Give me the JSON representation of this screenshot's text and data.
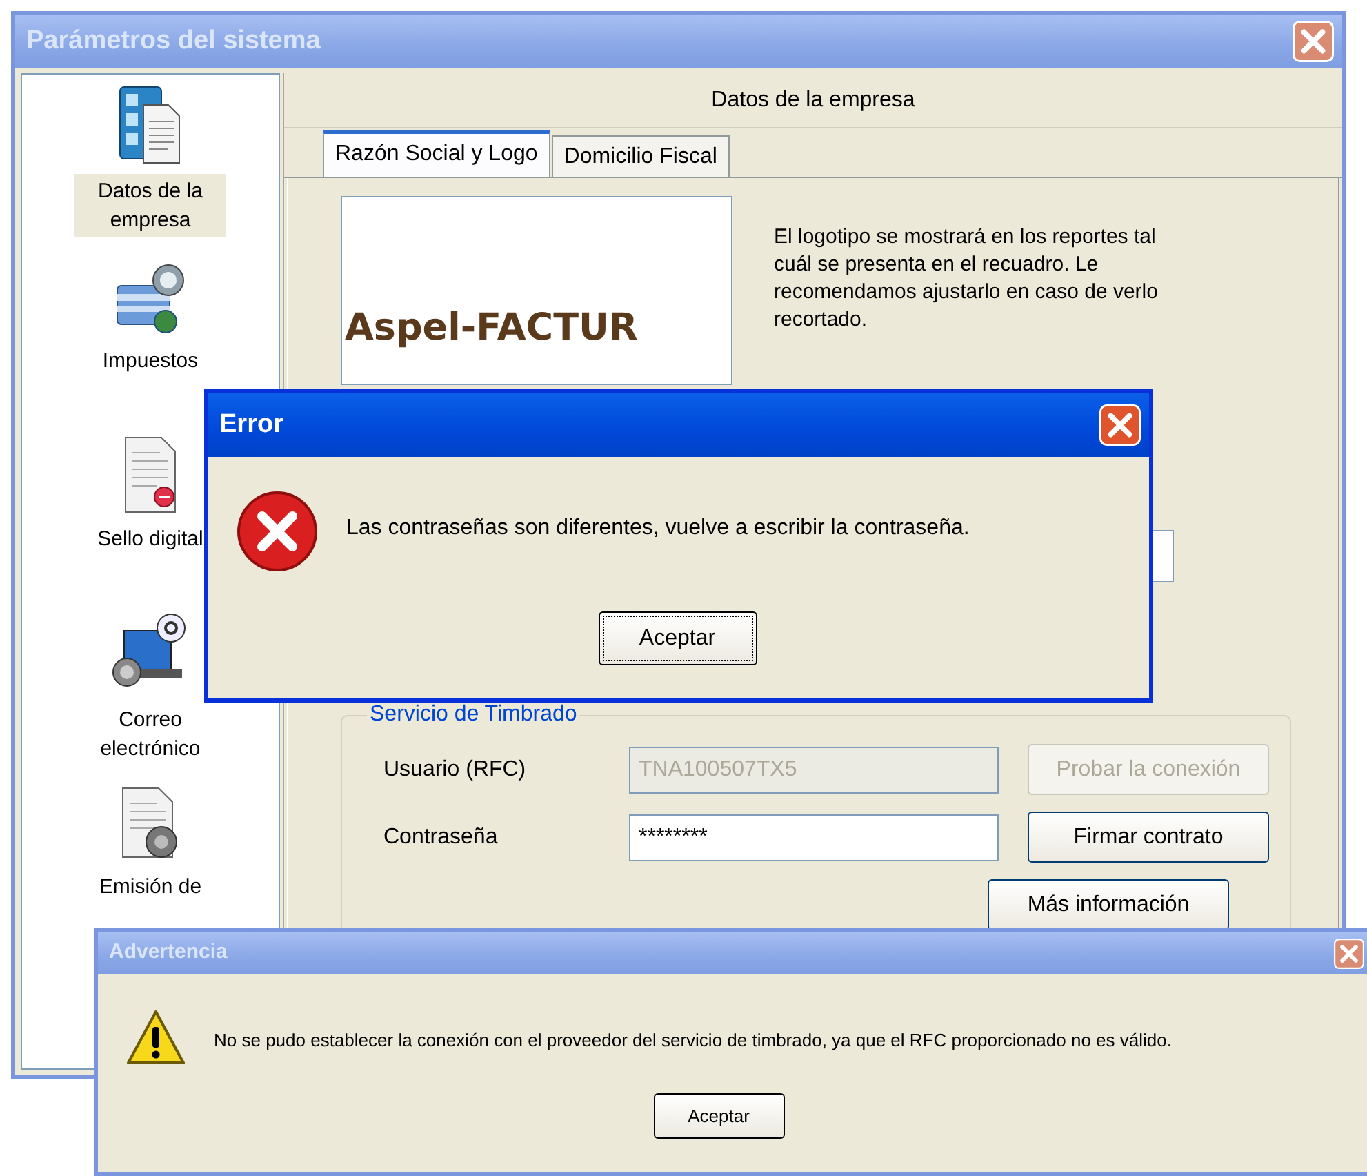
{
  "main_window": {
    "title": "Parámetros del sistema",
    "sidebar": {
      "items": [
        {
          "label": "Datos de la empresa",
          "selected": true,
          "kind": "company"
        },
        {
          "label": "Impuestos",
          "selected": false,
          "kind": "taxes"
        },
        {
          "label": "Sello digital",
          "selected": false,
          "kind": "seal"
        },
        {
          "label": "Correo electrónico",
          "selected": false,
          "kind": "email"
        },
        {
          "label": "Emisión de",
          "selected": false,
          "kind": "emission"
        }
      ]
    },
    "panel_title": "Datos de la empresa",
    "tabs": [
      {
        "label": "Razón Social y Logo",
        "selected": true
      },
      {
        "label": "Domicilio Fiscal",
        "selected": false
      }
    ],
    "logo": {
      "text": "Aspel-FACTUR"
    },
    "logo_note": "El logotipo se mostrará en los reportes tal cuál se presenta en el recuadro. Le recomendamos ajustarlo en caso de verlo recortado.",
    "timbrado": {
      "legend": "Servicio de Timbrado",
      "fields": [
        {
          "label": "Usuario (RFC)",
          "value": "TNA100507TX5",
          "disabled": true
        },
        {
          "label": "Contraseña",
          "value": "********",
          "disabled": false
        }
      ],
      "buttons": [
        {
          "label": "Probar la conexión",
          "disabled": true
        },
        {
          "label": "Firmar contrato",
          "disabled": false
        },
        {
          "label": "Más información",
          "disabled": false
        }
      ]
    }
  },
  "error_dialog": {
    "title": "Error",
    "active": true,
    "message": "Las contraseñas son diferentes, vuelve a escribir la contraseña.",
    "button": {
      "label": "Aceptar",
      "focused": true
    }
  },
  "warning_dialog": {
    "title": "Advertencia",
    "active": false,
    "message": "No se pudo establecer la conexión con el proveedor del servicio de timbrado, ya que el RFC  proporcionado no es válido.",
    "button": {
      "label": "Aceptar",
      "focused": false
    }
  }
}
